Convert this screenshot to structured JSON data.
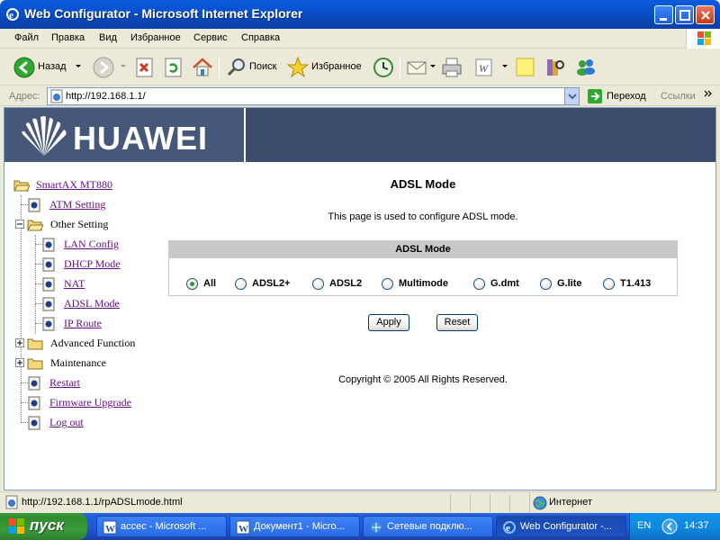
{
  "window": {
    "title": "Web Configurator - Microsoft Internet Explorer"
  },
  "menu": [
    "Файл",
    "Правка",
    "Вид",
    "Избранное",
    "Сервис",
    "Справка"
  ],
  "toolbar": {
    "back_label": "Назад",
    "search_label": "Поиск",
    "favorites_label": "Избранное"
  },
  "address": {
    "label": "Адрес:",
    "url": "http://192.168.1.1/",
    "go_label": "Переход",
    "links_label": "Ссылки"
  },
  "banner": {
    "brand": "HUAWEI"
  },
  "tree": {
    "root": "SmartAX MT880",
    "atm": "ATM Setting",
    "other": "Other Setting",
    "lan": "LAN Config",
    "dhcp": "DHCP Mode",
    "nat": "NAT",
    "adsl": "ADSL Mode",
    "iproute": "IP Route",
    "advanced": "Advanced Function",
    "maintenance": "Maintenance",
    "restart": "Restart",
    "firmware": "Firmware Upgrade",
    "logout": "Log out"
  },
  "main": {
    "title": "ADSL Mode",
    "description": "This page is used to configure ADSL mode.",
    "table_header": "ADSL Mode",
    "options": [
      "All",
      "ADSL2+",
      "ADSL2",
      "Multimode",
      "G.dmt",
      "G.lite",
      "T1.413"
    ],
    "selected": "All",
    "apply_label": "Apply",
    "reset_label": "Reset",
    "copyright": "Copyright © 2005 All Rights Reserved."
  },
  "status": {
    "url": "http://192.168.1.1/rpADSLmode.html",
    "zone": "Интернет"
  },
  "taskbar": {
    "start_label": "пуск",
    "tasks": [
      "accec - Microsoft ...",
      "Документ1 - Micro...",
      "Сетевые подклю...",
      "Web Configurator -..."
    ],
    "lang": "EN",
    "clock": "14:37"
  },
  "colors": {
    "banner": "#3B4B6B",
    "link_visited": "#6B0E8A",
    "titlebar": "#0A5DDE",
    "taskbar": "#245EDC",
    "start_button": "#3C9A3C"
  }
}
